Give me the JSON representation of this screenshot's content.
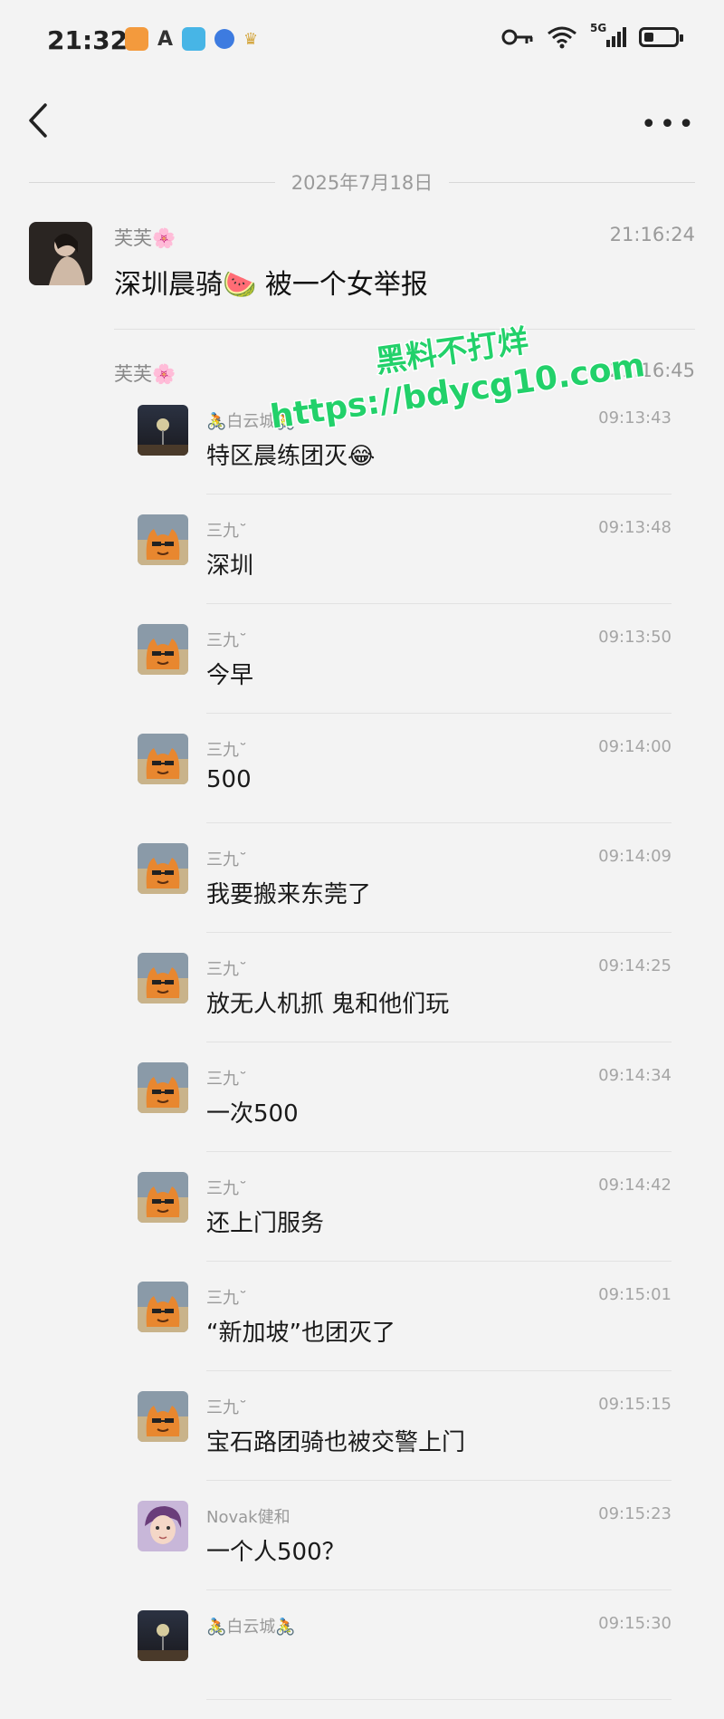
{
  "status_bar": {
    "time": "21:32",
    "network": "5G",
    "app_icons": [
      "taobao-icon",
      "text-app-icon",
      "book-app-icon",
      "globe-app-icon",
      "trophy-icon"
    ],
    "status_icons": [
      "key-icon",
      "wifi-icon",
      "signal-icon",
      "battery-icon"
    ]
  },
  "nav": {
    "back_icon": "chevron-left-icon",
    "more_label": "•••"
  },
  "date_separator": "2025年7月18日",
  "messages": [
    {
      "sender": "芙芙🌸",
      "time": "21:16:24",
      "text": "深圳晨骑🍉 被一个女举报"
    },
    {
      "sender": "芙芙🌸",
      "time": "21:16:45"
    }
  ],
  "forwarded": [
    {
      "name": "🚴白云城🚴",
      "time": "09:13:43",
      "text": "特区晨练团灭😂",
      "avatar": "night-tower"
    },
    {
      "name": "三九˘",
      "time": "09:13:48",
      "text": "深圳",
      "avatar": "cat"
    },
    {
      "name": "三九˘",
      "time": "09:13:50",
      "text": "今早",
      "avatar": "cat"
    },
    {
      "name": "三九˘",
      "time": "09:14:00",
      "text": "500",
      "avatar": "cat"
    },
    {
      "name": "三九˘",
      "time": "09:14:09",
      "text": "我要搬来东莞了",
      "avatar": "cat"
    },
    {
      "name": "三九˘",
      "time": "09:14:25",
      "text": "放无人机抓 鬼和他们玩",
      "avatar": "cat"
    },
    {
      "name": "三九˘",
      "time": "09:14:34",
      "text": "一次500",
      "avatar": "cat"
    },
    {
      "name": "三九˘",
      "time": "09:14:42",
      "text": "还上门服务",
      "avatar": "cat"
    },
    {
      "name": "三九˘",
      "time": "09:15:01",
      "text": "“新加坡”也团灭了",
      "avatar": "cat"
    },
    {
      "name": "三九˘",
      "time": "09:15:15",
      "text": "宝石路团骑也被交警上门",
      "avatar": "cat"
    },
    {
      "name": "Novak健和",
      "time": "09:15:23",
      "text": "一个人500？",
      "avatar": "anime"
    },
    {
      "name": "🚴白云城🚴",
      "time": "09:15:30",
      "text": "",
      "avatar": "night-tower"
    }
  ],
  "watermark": {
    "line1": "黑料不打烊",
    "line2": "https://bdycg10.com"
  },
  "colors": {
    "background": "#f3f3f3",
    "watermark_green": "#22d16a",
    "muted_text": "#9a9a9a"
  }
}
